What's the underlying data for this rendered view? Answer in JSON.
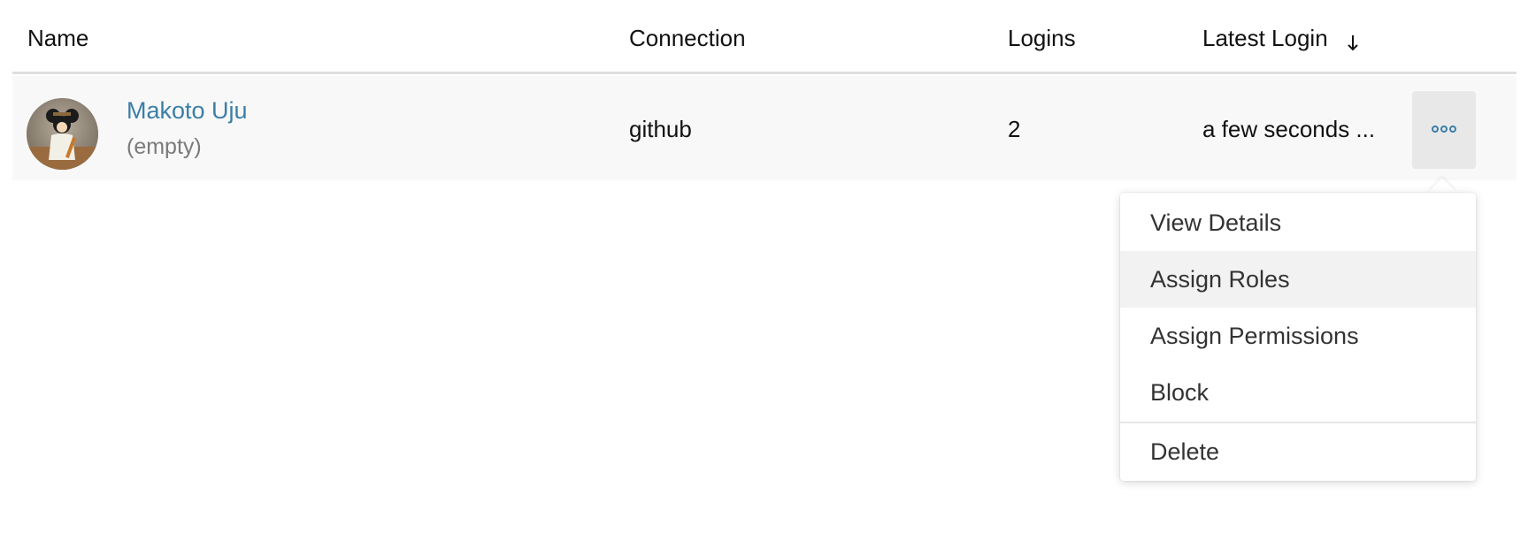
{
  "table": {
    "columns": {
      "name": "Name",
      "connection": "Connection",
      "logins": "Logins",
      "latest_login": "Latest Login"
    },
    "sort_icon": "arrow-down-icon",
    "rows": [
      {
        "name": "Makoto Uju",
        "email": "(empty)",
        "connection": "github",
        "logins": "2",
        "latest_login": "a few seconds ...",
        "avatar_icon": "user-avatar"
      }
    ]
  },
  "actions_menu": {
    "trigger_icon": "more-horizontal-icon",
    "items": [
      {
        "label": "View Details"
      },
      {
        "label": "Assign Roles",
        "highlighted": true
      },
      {
        "label": "Assign Permissions"
      },
      {
        "label": "Block"
      },
      {
        "label": "Delete"
      }
    ]
  },
  "colors": {
    "link": "#3b7ea7",
    "muted_text": "#7a7a7a",
    "row_background": "#f8f8f8",
    "button_background": "#e8e8e8",
    "menu_hover": "#f2f2f2",
    "header_border": "#dedede"
  }
}
